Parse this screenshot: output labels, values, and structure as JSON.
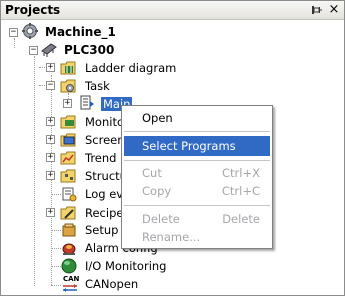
{
  "panel": {
    "title": "Projects"
  },
  "tree": {
    "machine": "Machine_1",
    "plc": "PLC300",
    "items": {
      "ladder": "Ladder diagram",
      "task": "Task",
      "main": "Main",
      "monitor": "Monitor",
      "screen": "Screen",
      "trend": "Trend",
      "structure": "Structur",
      "log": "Log eve",
      "recipe": "Recipe",
      "setup": "Setup c",
      "alarm": "Alarm config",
      "io": "I/O Monitoring",
      "canopen": "CANopen"
    },
    "canopen_icon_text": "CAN"
  },
  "context_menu": {
    "open": "Open",
    "select_programs": "Select Programs",
    "cut": "Cut",
    "cut_key": "Ctrl+X",
    "copy": "Copy",
    "copy_key": "Ctrl+C",
    "delete": "Delete",
    "delete_key": "Delete",
    "rename": "Rename..."
  },
  "colors": {
    "selection": "#316ac5",
    "disabled": "#a7a6aa"
  }
}
